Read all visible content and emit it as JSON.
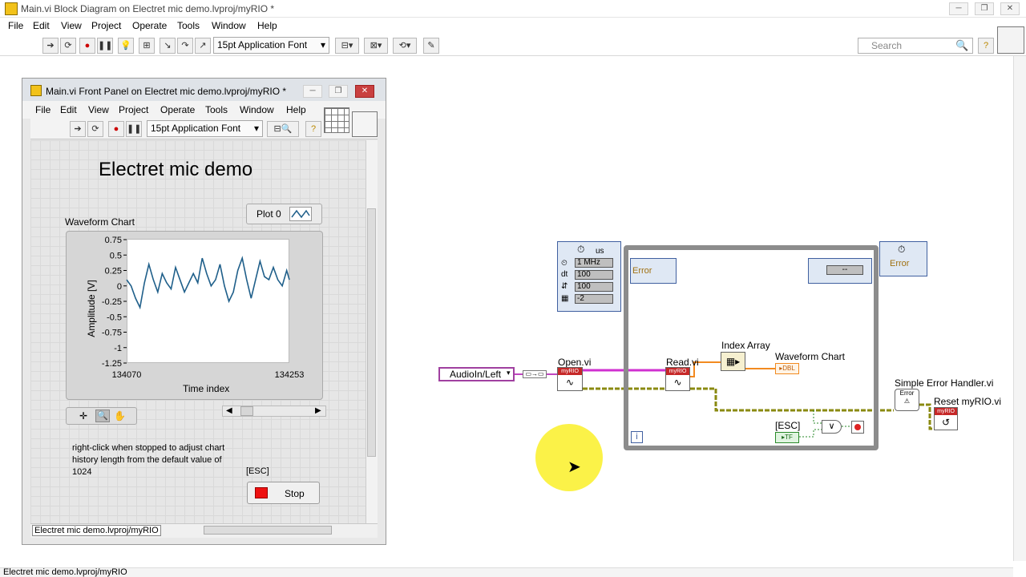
{
  "main_window": {
    "title": "Main.vi Block Diagram on Electret mic demo.lvproj/myRIO *",
    "menu": [
      "File",
      "Edit",
      "View",
      "Project",
      "Operate",
      "Tools",
      "Window",
      "Help"
    ],
    "font_select": "15pt Application Font",
    "search_placeholder": "Search",
    "status_path": "Electret mic demo.lvproj/myRIO"
  },
  "front_panel": {
    "title": "Main.vi Front Panel on Electret mic demo.lvproj/myRIO *",
    "menu": [
      "File",
      "Edit",
      "View",
      "Project",
      "Operate",
      "Tools",
      "Window",
      "Help"
    ],
    "font_select": "15pt Application Font",
    "heading": "Electret mic demo",
    "chart_label": "Waveform Chart",
    "plot_legend": "Plot 0",
    "note": "right-click when stopped to adjust chart history length from the default value of 1024",
    "esc_label": "[ESC]",
    "stop_label": "Stop",
    "status_path": "Electret mic demo.lvproj/myRIO"
  },
  "chart_data": {
    "type": "line",
    "title": "",
    "xlabel": "Time index",
    "ylabel": "Amplitude [V]",
    "xlim": [
      134070,
      134253
    ],
    "ylim": [
      -1.25,
      0.75
    ],
    "x_ticks": [
      "134070",
      "134253"
    ],
    "y_ticks": [
      "0.75",
      "0.5",
      "0.25",
      "0",
      "-0.25",
      "-0.5",
      "-0.75",
      "-1",
      "-1.25"
    ],
    "series": [
      {
        "name": "Plot 0",
        "color": "#1f5f8a",
        "x": [
          134070,
          134075,
          134080,
          134085,
          134090,
          134095,
          134100,
          134105,
          134110,
          134115,
          134120,
          134125,
          134130,
          134135,
          134140,
          134145,
          134150,
          134155,
          134160,
          134165,
          134170,
          134175,
          134180,
          134185,
          134190,
          134195,
          134200,
          134205,
          134210,
          134215,
          134220,
          134225,
          134230,
          134235,
          134240,
          134245,
          134250,
          134253
        ],
        "y": [
          0.1,
          0.0,
          -0.2,
          -0.35,
          0.05,
          0.35,
          0.1,
          -0.1,
          0.2,
          0.05,
          -0.05,
          0.3,
          0.1,
          -0.1,
          0.05,
          0.2,
          0.05,
          0.45,
          0.2,
          0.0,
          0.1,
          0.35,
          0.0,
          -0.25,
          -0.1,
          0.25,
          0.45,
          0.1,
          -0.2,
          0.1,
          0.4,
          0.15,
          0.1,
          0.3,
          0.1,
          0.0,
          0.25,
          0.1
        ]
      }
    ]
  },
  "block_diagram": {
    "timed_loop_left": {
      "unit": "us",
      "rows": [
        "1 MHz",
        "100",
        "100",
        "-2"
      ],
      "row_tags": [
        "",
        "dt",
        "",
        ""
      ]
    },
    "timed_loop_right_label": "Error",
    "left_error_label": "Error",
    "channel_constant": "AudioIn/Left",
    "open_label": "Open.vi",
    "read_label": "Read.vi",
    "index_array_label": "Index Array",
    "waveform_chart_label": "Waveform Chart",
    "dbl_tag": "DBL",
    "esc_label": "[ESC]",
    "tf_tag": "TF",
    "loop_iteration": "i",
    "simple_error_label": "Simple Error Handler.vi",
    "reset_label": "Reset myRIO.vi",
    "myrio_tag": "myRIO",
    "error_node_label": "Error",
    "dash_value": "--"
  }
}
